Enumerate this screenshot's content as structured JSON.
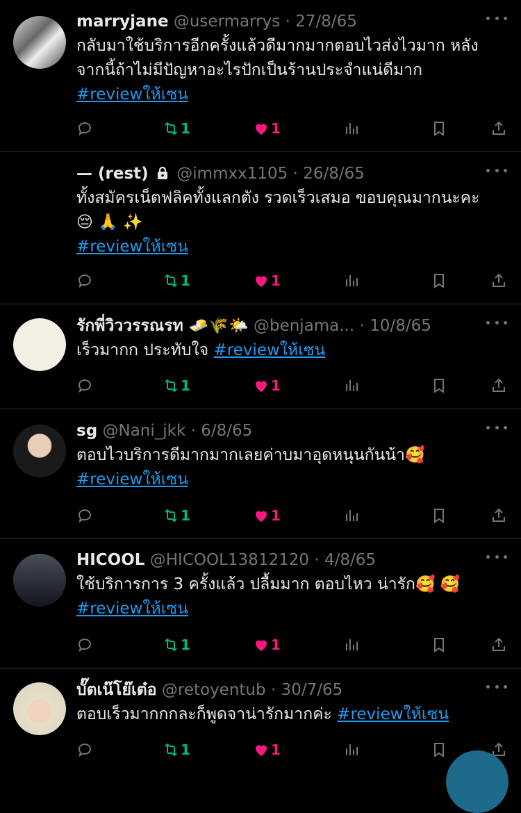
{
  "tweets": [
    {
      "name": "marryjane",
      "handle": "@usermarrys",
      "date": "27/8/65",
      "text_lines": [
        "กลับมาใช้บริการอีกครั้งแล้วดีมากมากตอบไวส่งไวมาก หลัง",
        "จากนี้ถ้าไม่มีปัญหาอะไรปักเป็นร้านประจำแน่ดีมาก"
      ],
      "hashtag": "#reviewให้เซน",
      "retweets": "1",
      "likes": "1"
    },
    {
      "name": "— (rest)",
      "handle": "@immxx1105",
      "date": "26/8/65",
      "text_lines": [
        "ทั้งสมัครเน็ตฟลิคทั้งแลกตัง รวดเร็วเสมอ ขอบคุณมากนะคะ",
        "😔 🙏 ✨"
      ],
      "hashtag": "#reviewให้เซน",
      "retweets": "1",
      "likes": "1"
    },
    {
      "name": "รักพี่วิววรรณรท 🧈🌾🌤️",
      "handle": "@benjama...",
      "date": "10/8/65",
      "text": "เร็วมากก ประทับใจ",
      "hashtag": "#reviewให้เซน",
      "retweets": "1",
      "likes": "1"
    },
    {
      "name": "sg",
      "handle": "@Nani_jkk",
      "date": "6/8/65",
      "text": "ตอบไวบริการดีมากมากเลยค่าบมาอุดหนุนกันน้า🥰",
      "hashtag": "#reviewให้เซน",
      "retweets": "1",
      "likes": "1"
    },
    {
      "name": "HICOOL",
      "handle": "@HICOOL13812120",
      "date": "4/8/65",
      "text": "ใช้บริการการ  3 ครั้งแล้ว ปลื้มมาก ตอบไหว น่ารัก🥰 🥰",
      "hashtag": "#reviewให้เซน",
      "retweets": "1",
      "likes": "1"
    },
    {
      "name": "บั๊ตเน๊โย๊เต๋อ",
      "handle": "@retoyentub",
      "date": "30/7/65",
      "text": "ตอบเร็วมากกกละก็พูดจาน่ารักมากค่ะ",
      "hashtag": "#reviewให้เซน",
      "retweets": "1",
      "likes": "1"
    }
  ],
  "separator": "·",
  "icons": [
    "reply-icon",
    "retweet-icon",
    "like-icon",
    "analytics-icon",
    "bookmark-icon",
    "share-icon",
    "more-icon",
    "lock-icon"
  ],
  "colors": {
    "background": "#000000",
    "text": "#e7e9ea",
    "secondary": "#71767b",
    "link": "#1d9bf0",
    "retweet": "#00ba7c",
    "like": "#f91880"
  }
}
